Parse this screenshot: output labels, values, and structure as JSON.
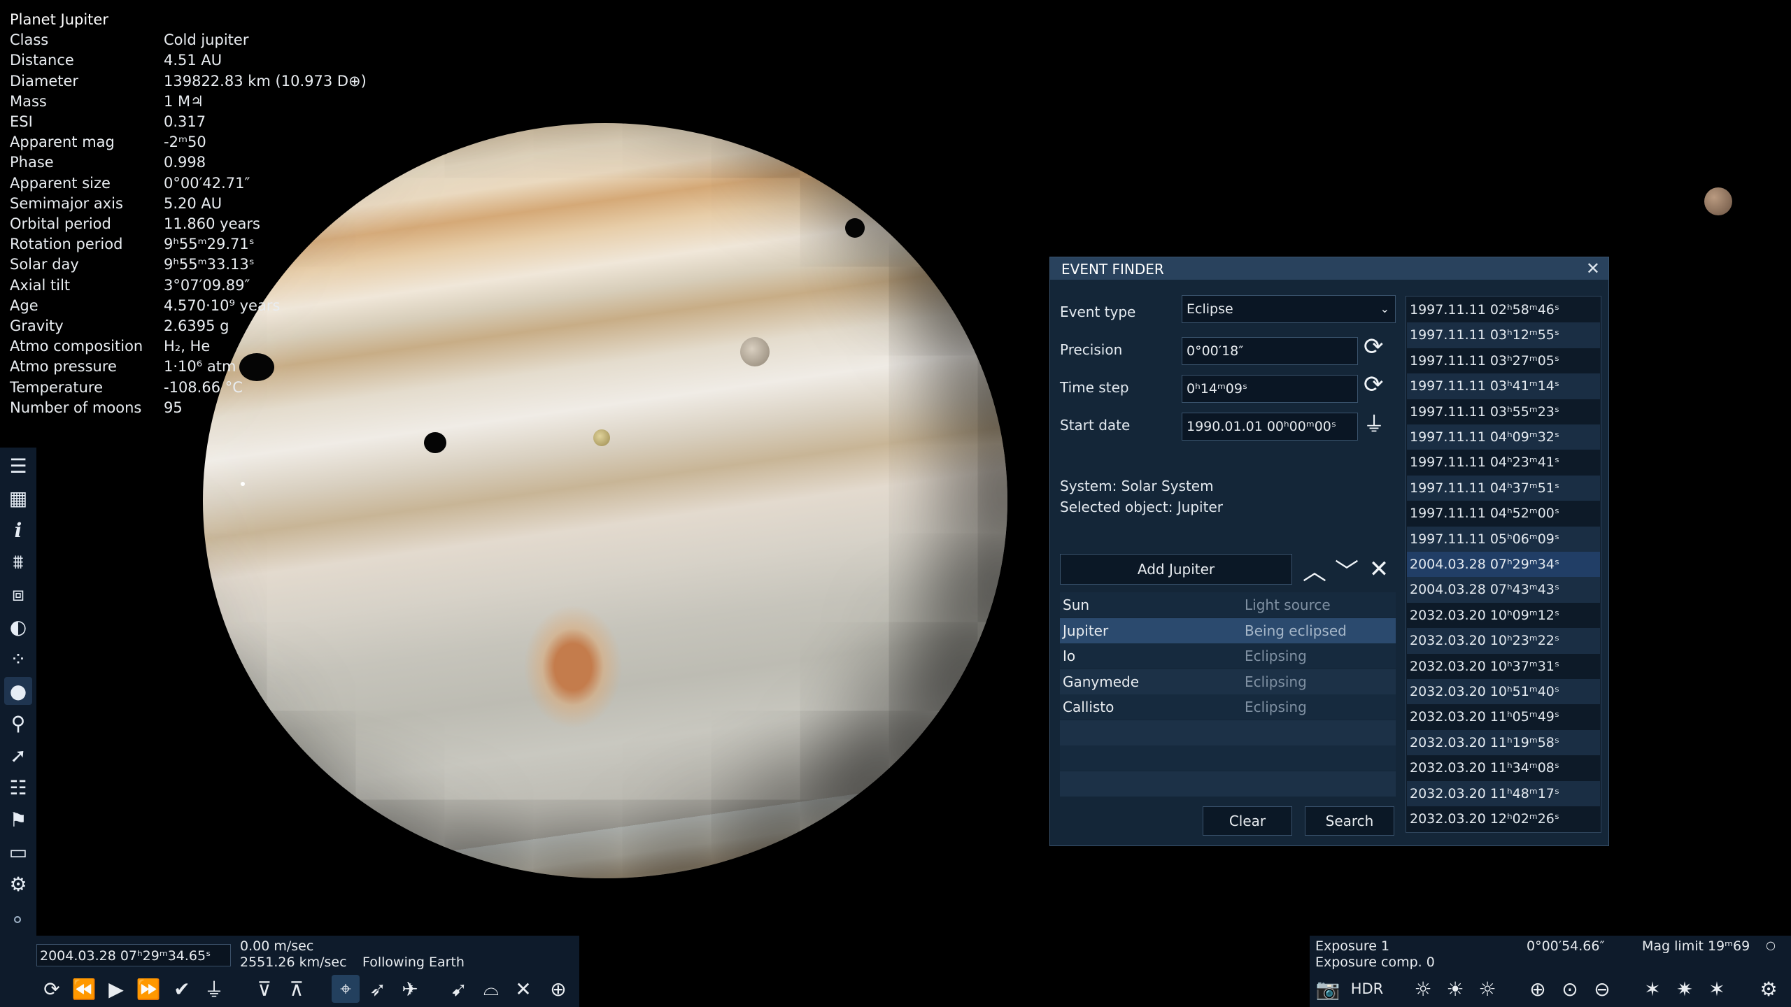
{
  "info": {
    "title": "Planet  Jupiter",
    "rows": [
      {
        "k": "Class",
        "v": "Cold jupiter"
      },
      {
        "k": "Distance",
        "v": "4.51 AU"
      },
      {
        "k": "Diameter",
        "v": "139822.83 km (10.973 D⊕)"
      },
      {
        "k": "Mass",
        "v": "1 M♃"
      },
      {
        "k": "ESI",
        "v": "0.317"
      },
      {
        "k": "Apparent mag",
        "v": "-2ᵐ50"
      },
      {
        "k": "Phase",
        "v": "0.998"
      },
      {
        "k": "Apparent size",
        "v": "0°00′42.71″"
      },
      {
        "k": "Semimajor axis",
        "v": "5.20 AU"
      },
      {
        "k": "Orbital period",
        "v": "11.860 years"
      },
      {
        "k": "Rotation period",
        "v": "9ʰ55ᵐ29.71ˢ"
      },
      {
        "k": "Solar day",
        "v": "9ʰ55ᵐ33.13ˢ"
      },
      {
        "k": "Axial tilt",
        "v": "3°07′09.89″"
      },
      {
        "k": "Age",
        "v": "4.570·10⁹ years"
      },
      {
        "k": "Gravity",
        "v": "2.6395 g"
      },
      {
        "k": "Atmo composition",
        "v": "H₂, He"
      },
      {
        "k": "Atmo pressure",
        "v": "1·10⁶ atm"
      },
      {
        "k": "Temperature",
        "v": "-108.66 °C"
      },
      {
        "k": "Number of moons",
        "v": "95"
      }
    ]
  },
  "event_finder": {
    "title": "EVENT FINDER",
    "close": "✕",
    "event_type_label": "Event type",
    "event_type_value": "Eclipse",
    "precision_label": "Precision",
    "precision_value": "0°00′18″",
    "time_step_label": "Time step",
    "time_step_value": "0ʰ14ᵐ09ˢ",
    "start_date_label": "Start date",
    "start_date_value": "1990.01.01 00ʰ00ᵐ00ˢ",
    "system_text": "System: Solar System",
    "selected_text": "Selected object: Jupiter",
    "add_button": "Add Jupiter",
    "objects": [
      {
        "name": "Sun",
        "role": "Light source"
      },
      {
        "name": "Jupiter",
        "role": "Being eclipsed"
      },
      {
        "name": "Io",
        "role": "Eclipsing"
      },
      {
        "name": "Ganymede",
        "role": "Eclipsing"
      },
      {
        "name": "Callisto",
        "role": "Eclipsing"
      }
    ],
    "clear_button": "Clear",
    "search_button": "Search",
    "results": [
      "1997.11.11 02ʰ58ᵐ46ˢ",
      "1997.11.11 03ʰ12ᵐ55ˢ",
      "1997.11.11 03ʰ27ᵐ05ˢ",
      "1997.11.11 03ʰ41ᵐ14ˢ",
      "1997.11.11 03ʰ55ᵐ23ˢ",
      "1997.11.11 04ʰ09ᵐ32ˢ",
      "1997.11.11 04ʰ23ᵐ41ˢ",
      "1997.11.11 04ʰ37ᵐ51ˢ",
      "1997.11.11 04ʰ52ᵐ00ˢ",
      "1997.11.11 05ʰ06ᵐ09ˢ",
      "2004.03.28 07ʰ29ᵐ34ˢ",
      "2004.03.28 07ʰ43ᵐ43ˢ",
      "2032.03.20 10ʰ09ᵐ12ˢ",
      "2032.03.20 10ʰ23ᵐ22ˢ",
      "2032.03.20 10ʰ37ᵐ31ˢ",
      "2032.03.20 10ʰ51ᵐ40ˢ",
      "2032.03.20 11ʰ05ᵐ49ˢ",
      "2032.03.20 11ʰ19ᵐ58ˢ",
      "2032.03.20 11ʰ34ᵐ08ˢ",
      "2032.03.20 11ʰ48ᵐ17ˢ",
      "2032.03.20 12ʰ02ᵐ26ˢ"
    ],
    "selected_result_index": 10
  },
  "bottom_left": {
    "date": "2004.03.28 07ʰ29ᵐ34.65ˢ",
    "speed1": "0.00 m/sec",
    "speed2": "2551.26 km/sec",
    "following": "Following Earth"
  },
  "bottom_right": {
    "exposure": "Exposure 1",
    "exposure_comp": "Exposure comp. 0",
    "fov": "0°00′54.66″",
    "mag_limit": "Mag limit 19ᵐ69",
    "hdr": "HDR"
  },
  "colors": {
    "panel_bg": "#142638",
    "header_bg": "#29425d",
    "selected_row": "#2b4a6e",
    "toolbar_bg": "#0e1b2b"
  }
}
